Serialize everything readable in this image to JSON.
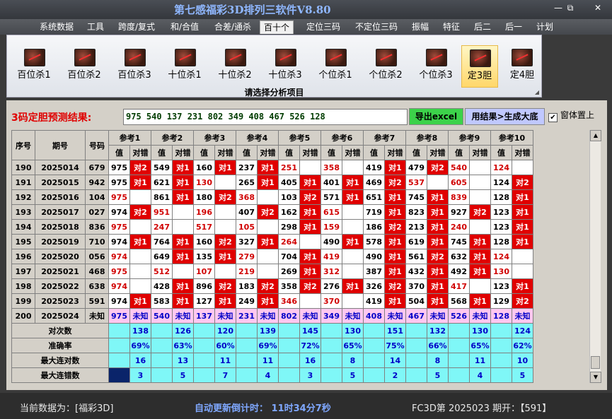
{
  "window": {
    "title": "第七感福彩3D排列三软件V8.80",
    "min": "—",
    "restore": "⧉",
    "close": "✕"
  },
  "menu": [
    "系统数据",
    "工具",
    "跨度/复式",
    "和/合值",
    "合差/通杀",
    "百十个",
    "定位三码",
    "不定位三码",
    "振幅",
    "特征",
    "后二",
    "后一",
    "计划"
  ],
  "active_menu": "百十个",
  "ribbon": {
    "buttons": [
      "百位杀1",
      "百位杀2",
      "百位杀3",
      "十位杀1",
      "十位杀2",
      "十位杀3",
      "个位杀1",
      "个位杀2",
      "个位杀3",
      "定3胆",
      "定4胆"
    ],
    "selected": "定3胆",
    "group_label": "请选择分析项目"
  },
  "result": {
    "label": "3码定胆预测结果:",
    "value": "975 540 137 231 802 349 408 467 526 128"
  },
  "buttons": {
    "export": "导出excel",
    "generate": "用结果>生成大底",
    "topmost": "窗体置上",
    "topmost_checked": true
  },
  "table": {
    "headers": {
      "seq": "序号",
      "period": "期号",
      "number": "号码",
      "ref": [
        "参考1",
        "参考2",
        "参考3",
        "参考4",
        "参考5",
        "参考6",
        "参考7",
        "参考8",
        "参考9",
        "参考10"
      ],
      "val": "值",
      "hit": "对错"
    },
    "rows": [
      {
        "seq": "190",
        "period": "2025014",
        "num": "679",
        "cells": [
          [
            "975",
            "对2",
            0
          ],
          [
            "549",
            "对1",
            0
          ],
          [
            "160",
            "对1",
            0
          ],
          [
            "237",
            "对1",
            0
          ],
          [
            "251",
            "",
            1
          ],
          [
            "358",
            "",
            1
          ],
          [
            "419",
            "对1",
            0
          ],
          [
            "479",
            "对2",
            0
          ],
          [
            "540",
            "",
            1
          ],
          [
            "124",
            "",
            1
          ]
        ]
      },
      {
        "seq": "191",
        "period": "2025015",
        "num": "942",
        "cells": [
          [
            "975",
            "对1",
            0
          ],
          [
            "621",
            "对1",
            0
          ],
          [
            "130",
            "",
            1
          ],
          [
            "265",
            "对1",
            0
          ],
          [
            "405",
            "对1",
            0
          ],
          [
            "401",
            "对1",
            0
          ],
          [
            "469",
            "对2",
            0
          ],
          [
            "537",
            "",
            1
          ],
          [
            "605",
            "",
            1
          ],
          [
            "124",
            "对2",
            0
          ]
        ]
      },
      {
        "seq": "192",
        "period": "2025016",
        "num": "104",
        "cells": [
          [
            "975",
            "",
            1
          ],
          [
            "861",
            "对1",
            0
          ],
          [
            "180",
            "对2",
            0
          ],
          [
            "368",
            "",
            1
          ],
          [
            "103",
            "对2",
            0
          ],
          [
            "571",
            "对1",
            0
          ],
          [
            "651",
            "对1",
            0
          ],
          [
            "745",
            "对1",
            0
          ],
          [
            "839",
            "",
            1
          ],
          [
            "128",
            "对1",
            0
          ]
        ]
      },
      {
        "seq": "193",
        "period": "2025017",
        "num": "027",
        "cells": [
          [
            "974",
            "对2",
            0
          ],
          [
            "951",
            "",
            1
          ],
          [
            "196",
            "",
            1
          ],
          [
            "407",
            "对2",
            0
          ],
          [
            "162",
            "对1",
            0
          ],
          [
            "615",
            "",
            1
          ],
          [
            "719",
            "对1",
            0
          ],
          [
            "823",
            "对1",
            0
          ],
          [
            "927",
            "对2",
            0
          ],
          [
            "123",
            "对1",
            0
          ]
        ]
      },
      {
        "seq": "194",
        "period": "2025018",
        "num": "836",
        "cells": [
          [
            "975",
            "",
            1
          ],
          [
            "247",
            "",
            1
          ],
          [
            "517",
            "",
            1
          ],
          [
            "105",
            "",
            1
          ],
          [
            "298",
            "对1",
            0
          ],
          [
            "159",
            "",
            1
          ],
          [
            "186",
            "对2",
            0
          ],
          [
            "213",
            "对1",
            0
          ],
          [
            "240",
            "",
            1
          ],
          [
            "123",
            "对1",
            0
          ]
        ]
      },
      {
        "seq": "195",
        "period": "2025019",
        "num": "710",
        "cells": [
          [
            "974",
            "对1",
            0
          ],
          [
            "764",
            "对1",
            0
          ],
          [
            "160",
            "对2",
            0
          ],
          [
            "327",
            "对1",
            0
          ],
          [
            "264",
            "",
            1
          ],
          [
            "490",
            "对1",
            0
          ],
          [
            "578",
            "对1",
            0
          ],
          [
            "619",
            "对1",
            0
          ],
          [
            "745",
            "对1",
            0
          ],
          [
            "128",
            "对1",
            0
          ]
        ]
      },
      {
        "seq": "196",
        "period": "2025020",
        "num": "056",
        "cells": [
          [
            "974",
            "",
            1
          ],
          [
            "649",
            "对1",
            0
          ],
          [
            "135",
            "对1",
            0
          ],
          [
            "279",
            "",
            1
          ],
          [
            "704",
            "对1",
            0
          ],
          [
            "419",
            "",
            1
          ],
          [
            "490",
            "对1",
            0
          ],
          [
            "561",
            "对2",
            0
          ],
          [
            "632",
            "对1",
            0
          ],
          [
            "124",
            "",
            1
          ]
        ]
      },
      {
        "seq": "197",
        "period": "2025021",
        "num": "468",
        "cells": [
          [
            "975",
            "",
            1
          ],
          [
            "512",
            "",
            1
          ],
          [
            "107",
            "",
            1
          ],
          [
            "219",
            "",
            1
          ],
          [
            "269",
            "对1",
            0
          ],
          [
            "312",
            "",
            1
          ],
          [
            "387",
            "对1",
            0
          ],
          [
            "432",
            "对1",
            0
          ],
          [
            "492",
            "对1",
            0
          ],
          [
            "130",
            "",
            1
          ]
        ]
      },
      {
        "seq": "198",
        "period": "2025022",
        "num": "638",
        "cells": [
          [
            "974",
            "",
            1
          ],
          [
            "428",
            "对1",
            0
          ],
          [
            "896",
            "对2",
            0
          ],
          [
            "183",
            "对2",
            0
          ],
          [
            "358",
            "对2",
            0
          ],
          [
            "276",
            "对1",
            0
          ],
          [
            "326",
            "对2",
            0
          ],
          [
            "370",
            "对1",
            0
          ],
          [
            "417",
            "",
            1
          ],
          [
            "123",
            "对1",
            0
          ]
        ]
      },
      {
        "seq": "199",
        "period": "2025023",
        "num": "591",
        "cells": [
          [
            "974",
            "对1",
            0
          ],
          [
            "583",
            "对1",
            0
          ],
          [
            "127",
            "对1",
            0
          ],
          [
            "249",
            "对1",
            0
          ],
          [
            "346",
            "",
            1
          ],
          [
            "370",
            "",
            1
          ],
          [
            "419",
            "对1",
            0
          ],
          [
            "504",
            "对1",
            0
          ],
          [
            "568",
            "对1",
            0
          ],
          [
            "129",
            "对2",
            0
          ]
        ]
      }
    ],
    "future": {
      "seq": "200",
      "period": "2025024",
      "num": "未知",
      "values": [
        "975",
        "540",
        "137",
        "231",
        "802",
        "349",
        "408",
        "467",
        "526",
        "128"
      ],
      "status": "未知"
    },
    "stats": [
      {
        "label": "对次数",
        "values": [
          "138",
          "126",
          "120",
          "139",
          "145",
          "130",
          "151",
          "132",
          "130",
          "124"
        ]
      },
      {
        "label": "准确率",
        "values": [
          "69%",
          "63%",
          "60%",
          "69%",
          "72%",
          "65%",
          "75%",
          "66%",
          "65%",
          "62%"
        ]
      },
      {
        "label": "最大连对数",
        "values": [
          "16",
          "13",
          "11",
          "11",
          "16",
          "8",
          "14",
          "8",
          "11",
          "10"
        ]
      },
      {
        "label": "最大连错数",
        "values": [
          "3",
          "5",
          "7",
          "4",
          "3",
          "5",
          "2",
          "5",
          "4",
          "5"
        ]
      }
    ]
  },
  "status": {
    "data_source": "当前数据为：[福彩3D]",
    "countdown": "自动更新倒计时：  11时34分7秒",
    "issue": "FC3D第  2025023  期开：【591】"
  },
  "colors": {
    "hit": "#e00000",
    "future": "#ffc8f0",
    "stats": "#7ff7f7",
    "selected": "#ffd76a"
  }
}
